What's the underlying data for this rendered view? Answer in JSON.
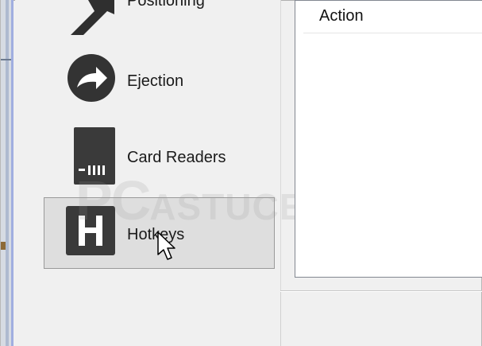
{
  "nav": {
    "items": [
      {
        "label": "Positioning",
        "icon": "arrow-icon"
      },
      {
        "label": "Ejection",
        "icon": "eject-arrow-icon"
      },
      {
        "label": "Card Readers",
        "icon": "sd-card-icon"
      },
      {
        "label": "Hotkeys",
        "icon": "hotkey-h-icon",
        "selected": true
      }
    ]
  },
  "table": {
    "columns": [
      "Action"
    ]
  },
  "watermark": {
    "big": "PC",
    "small": "ASTUCES"
  },
  "colors": {
    "icon_dark": "#3a3a3a",
    "selection_bg": "#dedede",
    "panel_bg": "#f0f0f0",
    "accent_strip": "#a0aee0"
  }
}
